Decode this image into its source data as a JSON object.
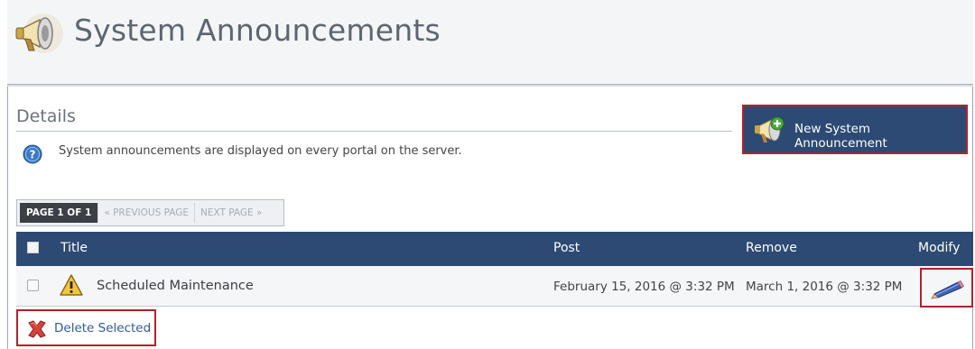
{
  "header": {
    "title": "System Announcements",
    "icon": "megaphone-icon"
  },
  "details": {
    "heading": "Details",
    "info_icon": "help-icon",
    "info_text": "System announcements are displayed on every portal on the server."
  },
  "new_button": {
    "label": "New System Announcement",
    "icon": "megaphone-add-icon"
  },
  "pager": {
    "current": "PAGE 1 OF 1",
    "previous": "« PREVIOUS PAGE",
    "next": "NEXT PAGE »"
  },
  "table": {
    "columns": [
      "Title",
      "Post",
      "Remove",
      "Modify"
    ],
    "rows": [
      {
        "icon": "warning-icon",
        "title": "Scheduled Maintenance",
        "post": "February 15, 2016 @ 3:32 PM",
        "remove": "March 1, 2016 @ 3:32 PM",
        "modify_icon": "pencil-icon"
      }
    ]
  },
  "delete_button": {
    "label": "Delete Selected",
    "icon": "delete-x-icon"
  },
  "colors": {
    "header_bar": "#2c4a73",
    "highlight_border": "#b0222a",
    "link": "#2e5c9a"
  }
}
